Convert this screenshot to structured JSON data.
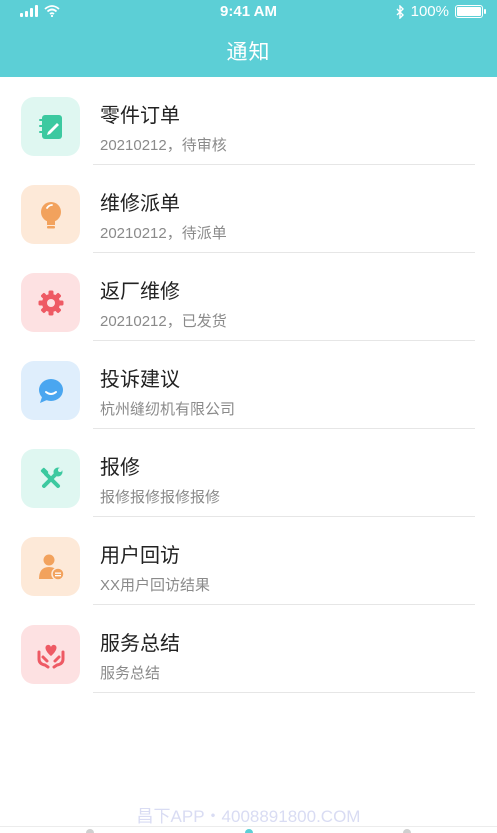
{
  "status_bar": {
    "time": "9:41 AM",
    "battery": "100%"
  },
  "header": {
    "title": "通知"
  },
  "notifications": [
    {
      "title": "零件订单",
      "subtitle": "20210212，待审核",
      "icon": "notebook-icon",
      "bg": "#dff7f1",
      "fg": "#3cc9a0"
    },
    {
      "title": "维修派单",
      "subtitle": "20210212，待派单",
      "icon": "lightbulb-icon",
      "bg": "#fde9d8",
      "fg": "#f2a25d"
    },
    {
      "title": "返厂维修",
      "subtitle": "20210212，已发货",
      "icon": "gear-icon",
      "bg": "#fde1e2",
      "fg": "#ee5a64"
    },
    {
      "title": "投诉建议",
      "subtitle": "杭州缝纫机有限公司",
      "icon": "chat-bubble-icon",
      "bg": "#dfeefc",
      "fg": "#4aa6f0"
    },
    {
      "title": "报修",
      "subtitle": "报修报修报修报修",
      "icon": "wrench-screwdriver-icon",
      "bg": "#dff7f1",
      "fg": "#3cc9a0"
    },
    {
      "title": "用户回访",
      "subtitle": "XX用户回访结果",
      "icon": "user-chat-icon",
      "bg": "#fde9d8",
      "fg": "#f2a25d"
    },
    {
      "title": "服务总结",
      "subtitle": "服务总结",
      "icon": "heart-hands-icon",
      "bg": "#fde1e2",
      "fg": "#ee5a64"
    }
  ],
  "watermark": "昌下APP・4008891800.COM"
}
